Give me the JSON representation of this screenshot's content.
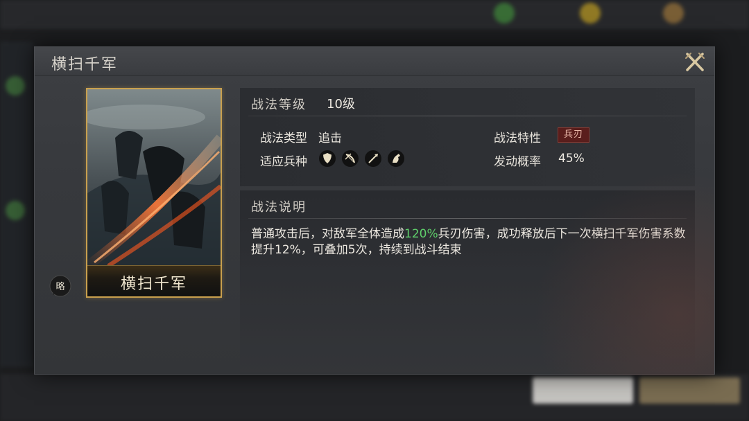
{
  "modal": {
    "title": "横扫千军",
    "close_icon": "close-icon"
  },
  "card": {
    "name": "横扫千军",
    "badge": "略"
  },
  "info": {
    "level_label": "战法等级",
    "level_value": "10级",
    "type_label": "战法类型",
    "type_value": "追击",
    "units_label": "适应兵种",
    "units": [
      "shield-icon",
      "bow-icon",
      "spear-icon",
      "horse-icon"
    ],
    "trait_label": "战法特性",
    "trait_value": "兵刃",
    "rate_label": "发动概率",
    "rate_value": "45%"
  },
  "description": {
    "heading": "战法说明",
    "part1": "普通攻击后，对敌军全体造成",
    "highlight": "120%",
    "part2": "兵刃伤害，成功释放后下一次横扫千军伤害系数提升12%，可叠加5次，持续到战斗结束"
  },
  "colors": {
    "accent_gold": "#c9a04e",
    "highlight_green": "#5fcf6b",
    "trait_red": "#5a1e1c"
  }
}
